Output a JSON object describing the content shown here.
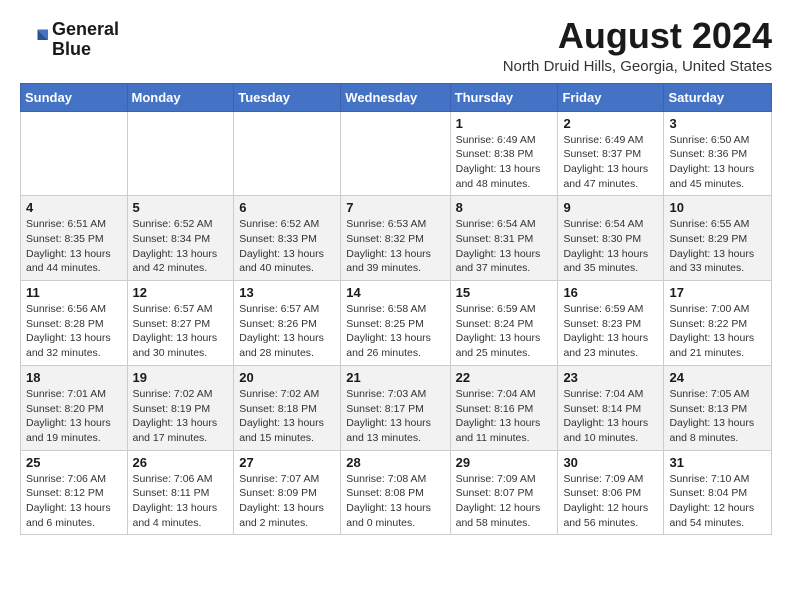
{
  "logo": {
    "line1": "General",
    "line2": "Blue"
  },
  "title": "August 2024",
  "subtitle": "North Druid Hills, Georgia, United States",
  "weekdays": [
    "Sunday",
    "Monday",
    "Tuesday",
    "Wednesday",
    "Thursday",
    "Friday",
    "Saturday"
  ],
  "weeks": [
    [
      {
        "day": "",
        "info": ""
      },
      {
        "day": "",
        "info": ""
      },
      {
        "day": "",
        "info": ""
      },
      {
        "day": "",
        "info": ""
      },
      {
        "day": "1",
        "info": "Sunrise: 6:49 AM\nSunset: 8:38 PM\nDaylight: 13 hours\nand 48 minutes."
      },
      {
        "day": "2",
        "info": "Sunrise: 6:49 AM\nSunset: 8:37 PM\nDaylight: 13 hours\nand 47 minutes."
      },
      {
        "day": "3",
        "info": "Sunrise: 6:50 AM\nSunset: 8:36 PM\nDaylight: 13 hours\nand 45 minutes."
      }
    ],
    [
      {
        "day": "4",
        "info": "Sunrise: 6:51 AM\nSunset: 8:35 PM\nDaylight: 13 hours\nand 44 minutes."
      },
      {
        "day": "5",
        "info": "Sunrise: 6:52 AM\nSunset: 8:34 PM\nDaylight: 13 hours\nand 42 minutes."
      },
      {
        "day": "6",
        "info": "Sunrise: 6:52 AM\nSunset: 8:33 PM\nDaylight: 13 hours\nand 40 minutes."
      },
      {
        "day": "7",
        "info": "Sunrise: 6:53 AM\nSunset: 8:32 PM\nDaylight: 13 hours\nand 39 minutes."
      },
      {
        "day": "8",
        "info": "Sunrise: 6:54 AM\nSunset: 8:31 PM\nDaylight: 13 hours\nand 37 minutes."
      },
      {
        "day": "9",
        "info": "Sunrise: 6:54 AM\nSunset: 8:30 PM\nDaylight: 13 hours\nand 35 minutes."
      },
      {
        "day": "10",
        "info": "Sunrise: 6:55 AM\nSunset: 8:29 PM\nDaylight: 13 hours\nand 33 minutes."
      }
    ],
    [
      {
        "day": "11",
        "info": "Sunrise: 6:56 AM\nSunset: 8:28 PM\nDaylight: 13 hours\nand 32 minutes."
      },
      {
        "day": "12",
        "info": "Sunrise: 6:57 AM\nSunset: 8:27 PM\nDaylight: 13 hours\nand 30 minutes."
      },
      {
        "day": "13",
        "info": "Sunrise: 6:57 AM\nSunset: 8:26 PM\nDaylight: 13 hours\nand 28 minutes."
      },
      {
        "day": "14",
        "info": "Sunrise: 6:58 AM\nSunset: 8:25 PM\nDaylight: 13 hours\nand 26 minutes."
      },
      {
        "day": "15",
        "info": "Sunrise: 6:59 AM\nSunset: 8:24 PM\nDaylight: 13 hours\nand 25 minutes."
      },
      {
        "day": "16",
        "info": "Sunrise: 6:59 AM\nSunset: 8:23 PM\nDaylight: 13 hours\nand 23 minutes."
      },
      {
        "day": "17",
        "info": "Sunrise: 7:00 AM\nSunset: 8:22 PM\nDaylight: 13 hours\nand 21 minutes."
      }
    ],
    [
      {
        "day": "18",
        "info": "Sunrise: 7:01 AM\nSunset: 8:20 PM\nDaylight: 13 hours\nand 19 minutes."
      },
      {
        "day": "19",
        "info": "Sunrise: 7:02 AM\nSunset: 8:19 PM\nDaylight: 13 hours\nand 17 minutes."
      },
      {
        "day": "20",
        "info": "Sunrise: 7:02 AM\nSunset: 8:18 PM\nDaylight: 13 hours\nand 15 minutes."
      },
      {
        "day": "21",
        "info": "Sunrise: 7:03 AM\nSunset: 8:17 PM\nDaylight: 13 hours\nand 13 minutes."
      },
      {
        "day": "22",
        "info": "Sunrise: 7:04 AM\nSunset: 8:16 PM\nDaylight: 13 hours\nand 11 minutes."
      },
      {
        "day": "23",
        "info": "Sunrise: 7:04 AM\nSunset: 8:14 PM\nDaylight: 13 hours\nand 10 minutes."
      },
      {
        "day": "24",
        "info": "Sunrise: 7:05 AM\nSunset: 8:13 PM\nDaylight: 13 hours\nand 8 minutes."
      }
    ],
    [
      {
        "day": "25",
        "info": "Sunrise: 7:06 AM\nSunset: 8:12 PM\nDaylight: 13 hours\nand 6 minutes."
      },
      {
        "day": "26",
        "info": "Sunrise: 7:06 AM\nSunset: 8:11 PM\nDaylight: 13 hours\nand 4 minutes."
      },
      {
        "day": "27",
        "info": "Sunrise: 7:07 AM\nSunset: 8:09 PM\nDaylight: 13 hours\nand 2 minutes."
      },
      {
        "day": "28",
        "info": "Sunrise: 7:08 AM\nSunset: 8:08 PM\nDaylight: 13 hours\nand 0 minutes."
      },
      {
        "day": "29",
        "info": "Sunrise: 7:09 AM\nSunset: 8:07 PM\nDaylight: 12 hours\nand 58 minutes."
      },
      {
        "day": "30",
        "info": "Sunrise: 7:09 AM\nSunset: 8:06 PM\nDaylight: 12 hours\nand 56 minutes."
      },
      {
        "day": "31",
        "info": "Sunrise: 7:10 AM\nSunset: 8:04 PM\nDaylight: 12 hours\nand 54 minutes."
      }
    ]
  ]
}
